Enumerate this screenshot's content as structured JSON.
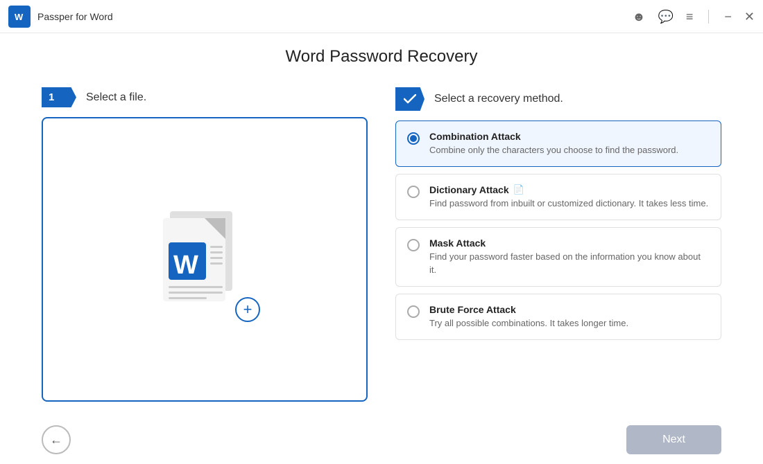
{
  "titleBar": {
    "logo": "W",
    "title": "Passper for Word",
    "icons": [
      "account",
      "chat",
      "menu",
      "minimize",
      "close"
    ]
  },
  "pageTitle": "Word Password Recovery",
  "stepOne": {
    "badgeNumber": "1",
    "label": "Select a file."
  },
  "stepTwo": {
    "label": "Select a recovery method."
  },
  "recoveryMethods": [
    {
      "id": "combination",
      "title": "Combination Attack",
      "description": "Combine only the characters you choose to find the password.",
      "selected": true
    },
    {
      "id": "dictionary",
      "title": "Dictionary Attack",
      "description": "Find password from inbuilt or customized dictionary. It takes less time.",
      "selected": false,
      "hasIcon": true
    },
    {
      "id": "mask",
      "title": "Mask Attack",
      "description": "Find your password faster based on the information you know about it.",
      "selected": false
    },
    {
      "id": "bruteforce",
      "title": "Brute Force Attack",
      "description": "Try all possible combinations. It takes longer time.",
      "selected": false
    }
  ],
  "buttons": {
    "back": "←",
    "next": "Next"
  }
}
